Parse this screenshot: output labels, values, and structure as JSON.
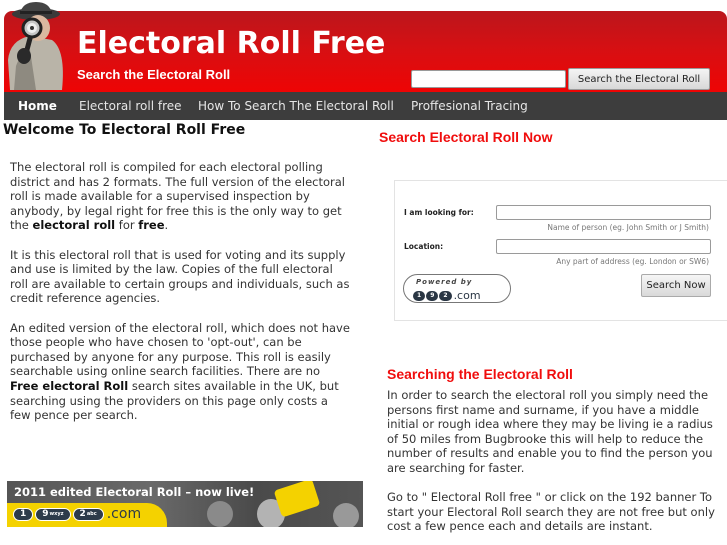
{
  "header": {
    "title": "Electoral Roll Free",
    "subtitle": "Search the Electoral Roll",
    "search_placeholder": "",
    "search_value": "",
    "search_button": "Search the Electoral Roll",
    "brand_color": "#e00c0c"
  },
  "nav": {
    "items": [
      {
        "label": "Home",
        "active": true
      },
      {
        "label": "Electoral roll free",
        "active": false
      },
      {
        "label": "How To Search The Electoral Roll",
        "active": false
      },
      {
        "label": "Proffesional Tracing",
        "active": false
      }
    ]
  },
  "left": {
    "title": "Welcome To Electoral Roll Free",
    "p1_a": "The electoral roll is compiled for each electoral polling district and has 2 formats. The full version of the electoral roll is made available for a supervised inspection by anybody, by legal right for free this is the only way to get the ",
    "p1_bold1": "electoral roll",
    "p1_b": " for ",
    "p1_bold2": "free",
    "p1_c": ".",
    "p2": "It is this electoral roll that is used for voting and its supply and use is limited by the law. Copies of the full electoral roll are available to certain groups and individuals, such as credit reference agencies.",
    "p3_a": "An edited version of the electoral roll, which does not have those people who have chosen to 'opt-out', can be purchased by anyone for any purpose. This roll is easily searchable using online search facilities. There are no ",
    "p3_bold": "Free electoral Roll",
    "p3_b": " search sites available in the UK, but searching using the providers on this page only costs a few pence per search.",
    "banner": {
      "headline": "2011 edited Electoral Roll – now live!",
      "logo_pills": [
        "1",
        "9",
        "2"
      ],
      "logo_pill_small": [
        "",
        "wxyz",
        "abc"
      ],
      "logo_suffix": ".com",
      "accent_color": "#f4d200"
    }
  },
  "right": {
    "search_title": "Search Electoral Roll Now",
    "form": {
      "looking_for_label": "I am looking for:",
      "looking_for_value": "",
      "looking_for_hint": "Name of person (eg. John Smith or J Smith)",
      "location_label": "Location:",
      "location_value": "",
      "location_hint": "Any part of address (eg. London or SW6)",
      "powered_by": "Powered by",
      "powered_logo_suffix": ".com",
      "submit": "Search Now"
    },
    "searching_title": "Searching the Electoral Roll",
    "p1": "In order to search the electoral roll you simply need the persons first name and surname, if you have a middle initial or rough idea where they may be living ie a radius of 50 miles from Bugbrooke this will help to reduce the number of results and enable you to find the person you are searching for faster.",
    "p2": "Go to \" Electoral Roll free \" or click on the 192 banner To start your Electoral Roll search they are not free but only cost a few pence each and details are instant."
  }
}
